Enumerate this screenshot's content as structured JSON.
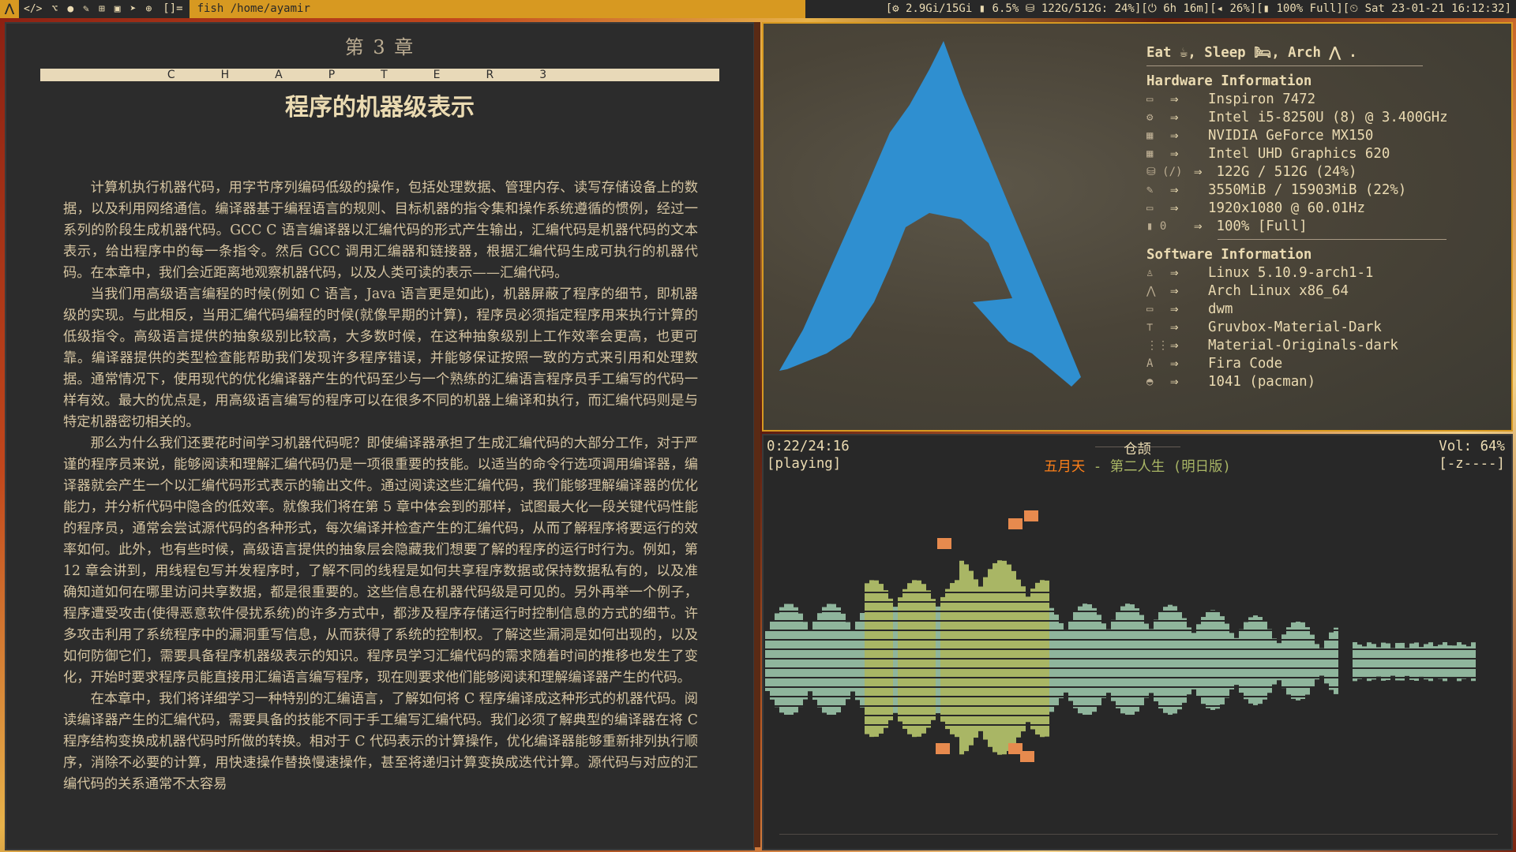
{
  "topbar": {
    "launcher_icon": "arch-icon",
    "tray_icons": [
      "code-icon",
      "git-icon",
      "chat-icon",
      "tools-icon",
      "windows-icon",
      "car-icon",
      "send-icon",
      "globe-icon"
    ],
    "tray_glyphs": [
      "</>",
      "⌥",
      "●",
      "✎",
      "⊞",
      "▣",
      "➤",
      "⊕"
    ],
    "layout_symbol": "[]=",
    "window_title": "fish /home/ayamir",
    "status": "[⚙ 2.9Gi/15Gi ▮ 6.5% ⛁ 122G/512G: 24%][⏻ 6h 16m][◂ 26%][▮ 100% Full][⏲ Sat 23-01-21 16:12:32]"
  },
  "pdf": {
    "chapter_number": "第 3 章",
    "chapter_band": "CHAPTER3",
    "chapter_title": "程序的机器级表示",
    "paragraphs": [
      "计算机执行机器代码，用字节序列编码低级的操作，包括处理数据、管理内存、读写存储设备上的数据，以及利用网络通信。编译器基于编程语言的规则、目标机器的指令集和操作系统遵循的惯例，经过一系列的阶段生成机器代码。GCC C 语言编译器以汇编代码的形式产生输出，汇编代码是机器代码的文本表示，给出程序中的每一条指令。然后 GCC 调用汇编器和链接器，根据汇编代码生成可执行的机器代码。在本章中，我们会近距离地观察机器代码，以及人类可读的表示——汇编代码。",
      "当我们用高级语言编程的时候(例如 C 语言，Java 语言更是如此)，机器屏蔽了程序的细节，即机器级的实现。与此相反，当用汇编代码编程的时候(就像早期的计算)，程序员必须指定程序用来执行计算的低级指令。高级语言提供的抽象级别比较高，大多数时候，在这种抽象级别上工作效率会更高，也更可靠。编译器提供的类型检查能帮助我们发现许多程序错误，并能够保证按照一致的方式来引用和处理数据。通常情况下，使用现代的优化编译器产生的代码至少与一个熟练的汇编语言程序员手工编写的代码一样有效。最大的优点是，用高级语言编写的程序可以在很多不同的机器上编译和执行，而汇编代码则是与特定机器密切相关的。",
      "那么为什么我们还要花时间学习机器代码呢？即使编译器承担了生成汇编代码的大部分工作，对于严谨的程序员来说，能够阅读和理解汇编代码仍是一项很重要的技能。以适当的命令行选项调用编译器，编译器就会产生一个以汇编代码形式表示的输出文件。通过阅读这些汇编代码，我们能够理解编译器的优化能力，并分析代码中隐含的低效率。就像我们将在第 5 章中体会到的那样，试图最大化一段关键代码性能的程序员，通常会尝试源代码的各种形式，每次编译并检查产生的汇编代码，从而了解程序将要运行的效率如何。此外，也有些时候，高级语言提供的抽象层会隐藏我们想要了解的程序的运行时行为。例如，第 12 章会讲到，用线程包写并发程序时，了解不同的线程是如何共享程序数据或保持数据私有的，以及准确知道如何在哪里访问共享数据，都是很重要的。这些信息在机器代码级是可见的。另外再举一个例子，程序遭受攻击(使得恶意软件侵扰系统)的许多方式中，都涉及程序存储运行时控制信息的方式的细节。许多攻击利用了系统程序中的漏洞重写信息，从而获得了系统的控制权。了解这些漏洞是如何出现的，以及如何防御它们，需要具备程序机器级表示的知识。程序员学习汇编代码的需求随着时间的推移也发生了变化，开始时要求程序员能直接用汇编语言编写程序，现在则要求他们能够阅读和理解编译器产生的代码。",
      "在本章中，我们将详细学习一种特别的汇编语言，了解如何将 C 程序编译成这种形式的机器代码。阅读编译器产生的汇编代码，需要具备的技能不同于手工编写汇编代码。我们必须了解典型的编译器在将 C 程序结构变换成机器代码时所做的转换。相对于 C 代码表示的计算操作，优化编译器能够重新排列执行顺序，消除不必要的计算，用快速操作替换慢速操作，甚至将递归计算变换成迭代计算。源代码与对应的汇编代码的关系通常不太容易"
    ]
  },
  "neofetch": {
    "greeting": "Eat ☕, Sleep 🛏, Arch ⋀ .",
    "hw_title": "Hardware Information",
    "arrow": "⇒",
    "hw": [
      {
        "icon": "laptop-icon",
        "glyph": "▭",
        "key": "",
        "value": "Inspiron 7472"
      },
      {
        "icon": "cpu-icon",
        "glyph": "⚙",
        "key": "",
        "value": "Intel i5-8250U (8) @ 3.400GHz"
      },
      {
        "icon": "gpu-icon",
        "glyph": "▦",
        "key": "",
        "value": "NVIDIA GeForce MX150"
      },
      {
        "icon": "gpu-icon",
        "glyph": "▦",
        "key": "",
        "value": "Intel UHD Graphics 620"
      },
      {
        "icon": "disk-icon",
        "glyph": "⛁",
        "key": "(/)",
        "value": " 122G / 512G (24%)"
      },
      {
        "icon": "memory-icon",
        "glyph": "✎",
        "key": "",
        "value": "3550MiB / 15903MiB (22%)"
      },
      {
        "icon": "monitor-icon",
        "glyph": "▭",
        "key": "",
        "value": "1920x1080 @ 60.01Hz"
      },
      {
        "icon": "battery-icon",
        "glyph": "▮",
        "key": "0",
        "value": " 100% [Full]"
      }
    ],
    "sw_title": "Software Information",
    "sw": [
      {
        "icon": "tux-icon",
        "glyph": "♙",
        "value": "Linux 5.10.9-arch1-1"
      },
      {
        "icon": "arch-icon",
        "glyph": "⋀",
        "value": "Arch Linux x86_64"
      },
      {
        "icon": "window-icon",
        "glyph": "▭",
        "value": "dwm"
      },
      {
        "icon": "paint-roller-icon",
        "glyph": "⊤",
        "value": "Gruvbox-Material-Dark"
      },
      {
        "icon": "icons-grid-icon",
        "glyph": "⋮⋮",
        "value": "Material-Originals-dark"
      },
      {
        "icon": "font-icon",
        "glyph": "A",
        "value": "Fira Code"
      },
      {
        "icon": "package-icon",
        "glyph": "◓",
        "value": "1041 (pacman)"
      }
    ],
    "colors": {
      "logo": "#2f8fd0",
      "accent": "#d79921"
    }
  },
  "cmus": {
    "time": "0:22/24:16",
    "state": "[playing]",
    "album": "仓颉",
    "volume": "Vol: 64%",
    "flags": "[-z----]",
    "artist": "五月天",
    "separator": " - ",
    "song": "第二人生 (明日版)"
  }
}
